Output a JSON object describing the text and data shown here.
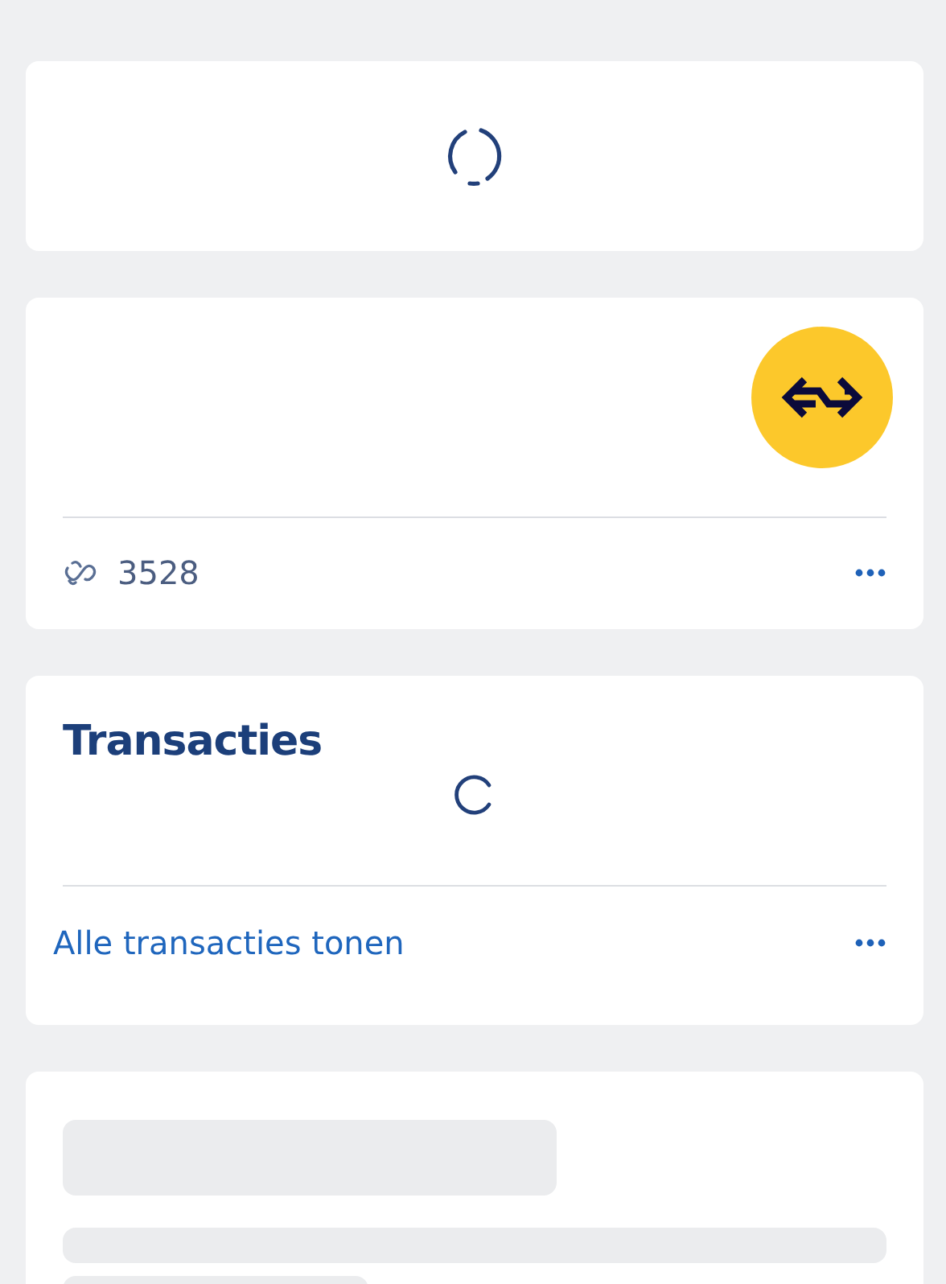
{
  "cards": [
    {
      "kind": "loading"
    },
    {
      "kind": "account",
      "number": "3528"
    },
    {
      "kind": "transactions",
      "title": "Transacties",
      "link": "Alle transacties tonen"
    },
    {
      "kind": "skeleton"
    }
  ]
}
